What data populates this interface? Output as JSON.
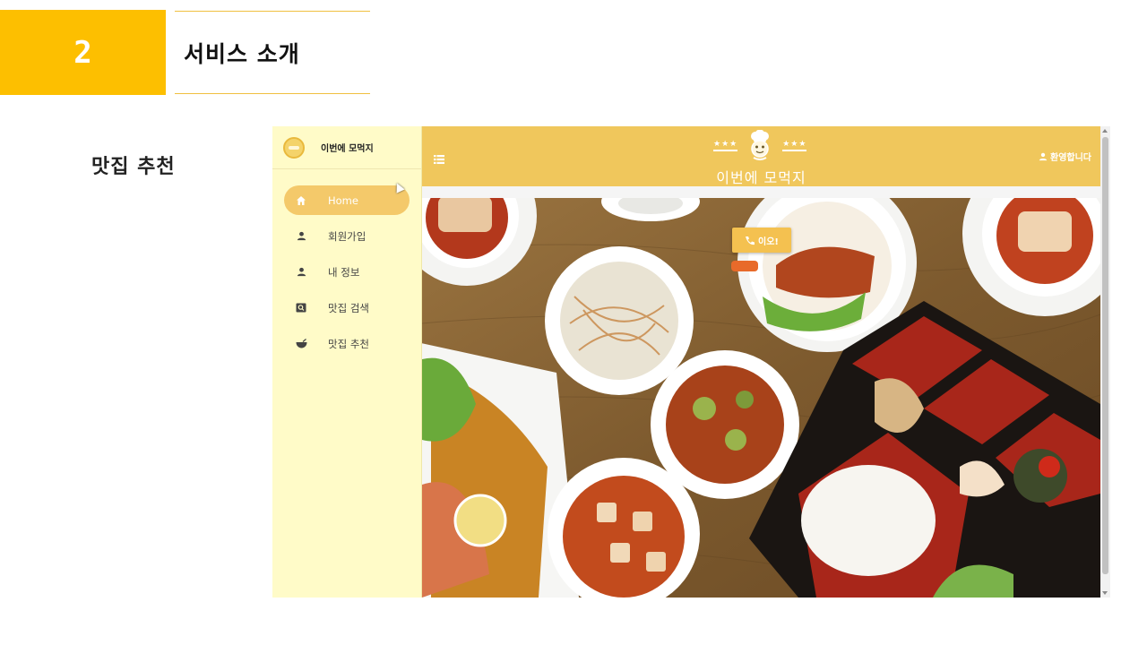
{
  "slide": {
    "number": "2",
    "title": "서비스 소개",
    "side_label": "맛집 추천"
  },
  "app": {
    "brand": "이번에 모먹지",
    "title": "이번에 모먹지",
    "stars_left": "★★★",
    "stars_right": "★★★",
    "welcome": "환영합니다",
    "call_button": "이오!",
    "nav": [
      {
        "label": "Home",
        "icon": "home-icon",
        "active": true
      },
      {
        "label": "회원가입",
        "icon": "person-icon"
      },
      {
        "label": "내 정보",
        "icon": "person-icon"
      },
      {
        "label": "맛집 검색",
        "icon": "search-box-icon"
      },
      {
        "label": "맛집 추천",
        "icon": "bowl-icon"
      }
    ],
    "colors": {
      "accent": "#fdbf00",
      "topbar": "#f0c75c",
      "sidebar": "#fffbc8",
      "active_nav": "#f4c96a"
    }
  }
}
